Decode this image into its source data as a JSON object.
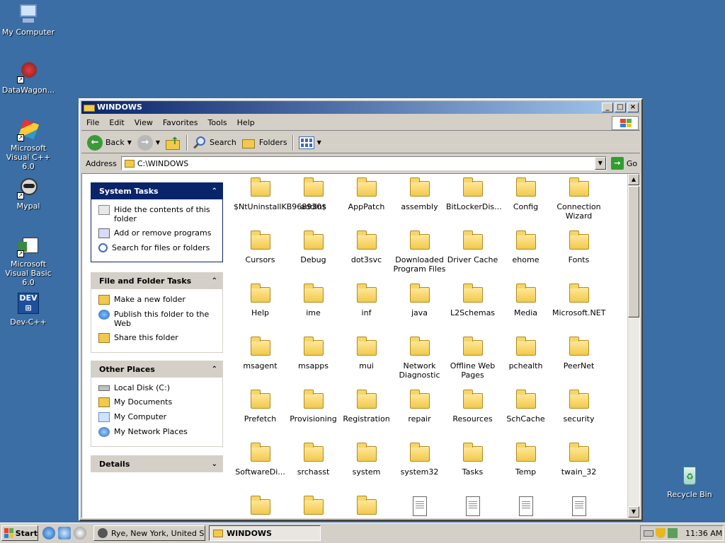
{
  "desktop": {
    "icons": [
      {
        "label": "My Computer",
        "icon": "computer-icon"
      },
      {
        "label": "DataWagon...",
        "icon": "datawagon-icon"
      },
      {
        "label": "Microsoft Visual C++ 6.0",
        "icon": "visual-cpp-icon"
      },
      {
        "label": "Mypal",
        "icon": "mypal-icon"
      },
      {
        "label": "Microsoft Visual Basic 6.0",
        "icon": "visual-basic-icon"
      },
      {
        "label": "Dev-C++",
        "icon": "devcpp-icon"
      },
      {
        "label": "Recycle Bin",
        "icon": "recycle-bin-icon"
      }
    ]
  },
  "window": {
    "title": "WINDOWS",
    "menu": [
      "File",
      "Edit",
      "View",
      "Favorites",
      "Tools",
      "Help"
    ],
    "toolbar": {
      "back": "Back",
      "search": "Search",
      "folders": "Folders"
    },
    "address": {
      "label": "Address",
      "value": "C:\\WINDOWS",
      "go": "Go"
    }
  },
  "taskpane": {
    "system_tasks": {
      "title": "System Tasks",
      "items": [
        "Hide the contents of this folder",
        "Add or remove programs",
        "Search for files or folders"
      ]
    },
    "file_folder_tasks": {
      "title": "File and Folder Tasks",
      "items": [
        "Make a new folder",
        "Publish this folder to the Web",
        "Share this folder"
      ]
    },
    "other_places": {
      "title": "Other Places",
      "items": [
        "Local Disk (C:)",
        "My Documents",
        "My Computer",
        "My Network Places"
      ]
    },
    "details": {
      "title": "Details"
    }
  },
  "files": [
    {
      "name": "$NtUninstallKB968930$",
      "type": "folder"
    },
    {
      "name": "addins",
      "type": "folder"
    },
    {
      "name": "AppPatch",
      "type": "folder"
    },
    {
      "name": "assembly",
      "type": "folder"
    },
    {
      "name": "BitLockerDis...",
      "type": "folder"
    },
    {
      "name": "Config",
      "type": "folder"
    },
    {
      "name": "Connection Wizard",
      "type": "folder"
    },
    {
      "name": "Cursors",
      "type": "folder"
    },
    {
      "name": "Debug",
      "type": "folder"
    },
    {
      "name": "dot3svc",
      "type": "folder"
    },
    {
      "name": "Downloaded Program Files",
      "type": "folder"
    },
    {
      "name": "Driver Cache",
      "type": "folder"
    },
    {
      "name": "ehome",
      "type": "folder"
    },
    {
      "name": "Fonts",
      "type": "folder"
    },
    {
      "name": "Help",
      "type": "folder"
    },
    {
      "name": "ime",
      "type": "folder"
    },
    {
      "name": "inf",
      "type": "folder"
    },
    {
      "name": "java",
      "type": "folder"
    },
    {
      "name": "L2Schemas",
      "type": "folder"
    },
    {
      "name": "Media",
      "type": "folder"
    },
    {
      "name": "Microsoft.NET",
      "type": "folder"
    },
    {
      "name": "msagent",
      "type": "folder"
    },
    {
      "name": "msapps",
      "type": "folder"
    },
    {
      "name": "mui",
      "type": "folder"
    },
    {
      "name": "Network Diagnostic",
      "type": "folder"
    },
    {
      "name": "Offline Web Pages",
      "type": "folder"
    },
    {
      "name": "pchealth",
      "type": "folder"
    },
    {
      "name": "PeerNet",
      "type": "folder"
    },
    {
      "name": "Prefetch",
      "type": "folder"
    },
    {
      "name": "Provisioning",
      "type": "folder"
    },
    {
      "name": "Registration",
      "type": "folder"
    },
    {
      "name": "repair",
      "type": "folder"
    },
    {
      "name": "Resources",
      "type": "folder"
    },
    {
      "name": "SchCache",
      "type": "folder"
    },
    {
      "name": "security",
      "type": "folder"
    },
    {
      "name": "SoftwareDi...",
      "type": "folder"
    },
    {
      "name": "srchasst",
      "type": "folder"
    },
    {
      "name": "system",
      "type": "folder"
    },
    {
      "name": "system32",
      "type": "folder"
    },
    {
      "name": "Tasks",
      "type": "folder"
    },
    {
      "name": "Temp",
      "type": "folder"
    },
    {
      "name": "twain_32",
      "type": "folder"
    },
    {
      "name": "",
      "type": "folder"
    },
    {
      "name": "",
      "type": "folder"
    },
    {
      "name": "",
      "type": "folder"
    },
    {
      "name": "",
      "type": "file"
    },
    {
      "name": "",
      "type": "file"
    },
    {
      "name": "",
      "type": "file"
    },
    {
      "name": "",
      "type": "file"
    }
  ],
  "taskbar": {
    "start": "Start",
    "tasks": [
      {
        "label": "Rye, New York, United S...",
        "active": false
      },
      {
        "label": "WINDOWS",
        "active": true
      }
    ],
    "clock": "11:36 AM"
  }
}
